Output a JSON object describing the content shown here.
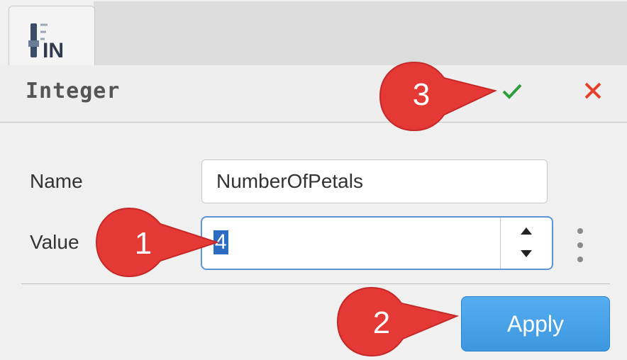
{
  "panel": {
    "title": "Integer",
    "tab_icon": "integer-input-icon"
  },
  "actions": {
    "ok_icon": "check-icon",
    "cancel_icon": "close-icon"
  },
  "form": {
    "name_label": "Name",
    "name_value": "NumberOfPetals",
    "value_label": "Value",
    "value_value": "4",
    "apply_label": "Apply"
  },
  "callouts": [
    "1",
    "2",
    "3"
  ],
  "colors": {
    "accent": "#3d97df",
    "ok": "#2e9e3a",
    "cancel": "#e5402b",
    "callout": "#e53935",
    "selection": "#2c6dc3"
  }
}
